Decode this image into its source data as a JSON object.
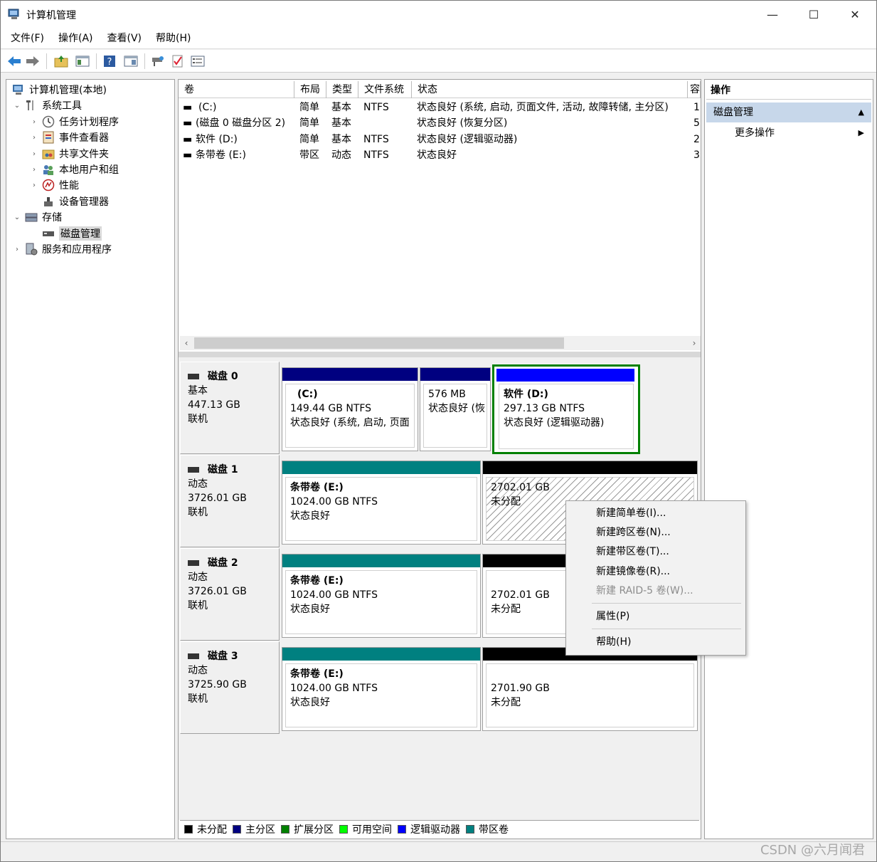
{
  "window": {
    "title": "计算机管理",
    "minimize": "—",
    "maximize": "☐",
    "close": "✕"
  },
  "menu": [
    "文件(F)",
    "操作(A)",
    "查看(V)",
    "帮助(H)"
  ],
  "toolbar_icons": [
    "back-icon",
    "forward-icon",
    "up-folder-icon",
    "show-hide-tree-icon",
    "help-icon",
    "properties-icon",
    "connect-icon",
    "check-icon",
    "list-icon"
  ],
  "tree": [
    {
      "label": "计算机管理(本地)",
      "icon": "computer-management-icon"
    },
    {
      "label": "系统工具",
      "icon": "tools-icon"
    },
    {
      "label": "任务计划程序",
      "icon": "clock-icon"
    },
    {
      "label": "事件查看器",
      "icon": "event-viewer-icon"
    },
    {
      "label": "共享文件夹",
      "icon": "shared-folder-icon"
    },
    {
      "label": "本地用户和组",
      "icon": "users-icon"
    },
    {
      "label": "性能",
      "icon": "performance-icon"
    },
    {
      "label": "设备管理器",
      "icon": "device-manager-icon"
    },
    {
      "label": "存储",
      "icon": "storage-icon"
    },
    {
      "label": "磁盘管理",
      "icon": "disk-icon"
    },
    {
      "label": "服务和应用程序",
      "icon": "services-icon"
    }
  ],
  "volumes": {
    "headers": [
      "卷",
      "布局",
      "类型",
      "文件系统",
      "状态",
      "容"
    ],
    "rows": [
      [
        "(C:)",
        "简单",
        "基本",
        "NTFS",
        "状态良好 (系统, 启动, 页面文件, 活动, 故障转储, 主分区)",
        "1"
      ],
      [
        "(磁盘 0 磁盘分区 2)",
        "简单",
        "基本",
        "",
        "状态良好 (恢复分区)",
        "5"
      ],
      [
        "软件 (D:)",
        "简单",
        "基本",
        "NTFS",
        "状态良好 (逻辑驱动器)",
        "2"
      ],
      [
        "条带卷 (E:)",
        "带区",
        "动态",
        "NTFS",
        "状态良好",
        "3"
      ]
    ]
  },
  "scroll": {
    "left": "‹",
    "right": "›"
  },
  "disks": [
    {
      "name": "磁盘 0",
      "type": "基本",
      "size": "447.13 GB",
      "status": "联机",
      "partitions": [
        {
          "name": "(C:)",
          "size": "149.44 GB NTFS",
          "status": "状态良好 (系统, 启动, 页面"
        },
        {
          "name": "",
          "size": "576 MB",
          "status": "状态良好 (恢"
        },
        {
          "name": "软件  (D:)",
          "size": "297.13 GB NTFS",
          "status": "状态良好 (逻辑驱动器)"
        }
      ]
    },
    {
      "name": "磁盘 1",
      "type": "动态",
      "size": "3726.01 GB",
      "status": "联机",
      "partitions": [
        {
          "name": "条带卷  (E:)",
          "size": "1024.00 GB NTFS",
          "status": "状态良好"
        },
        {
          "name": "",
          "size": "2702.01 GB",
          "status": "未分配"
        }
      ]
    },
    {
      "name": "磁盘 2",
      "type": "动态",
      "size": "3726.01 GB",
      "status": "联机",
      "partitions": [
        {
          "name": "条带卷  (E:)",
          "size": "1024.00 GB NTFS",
          "status": "状态良好"
        },
        {
          "name": "",
          "size": "2702.01 GB",
          "status": "未分配"
        }
      ]
    },
    {
      "name": "磁盘 3",
      "type": "动态",
      "size": "3725.90 GB",
      "status": "联机",
      "partitions": [
        {
          "name": "条带卷  (E:)",
          "size": "1024.00 GB NTFS",
          "status": "状态良好"
        },
        {
          "name": "",
          "size": "2701.90 GB",
          "status": "未分配"
        }
      ]
    }
  ],
  "legend": [
    {
      "label": "未分配",
      "color": "#000000"
    },
    {
      "label": "主分区",
      "color": "#000080"
    },
    {
      "label": "扩展分区",
      "color": "#008000"
    },
    {
      "label": "可用空间",
      "color": "#00ff00"
    },
    {
      "label": "逻辑驱动器",
      "color": "#0000ff"
    },
    {
      "label": "带区卷",
      "color": "#008080"
    }
  ],
  "colors": {
    "primary": "#000080",
    "logical": "#0000ff",
    "striped": "#008080",
    "unallocated": "#000000",
    "selection_border": "#008000"
  },
  "actions": {
    "header": "操作",
    "section": "磁盘管理",
    "section_arrow": "▲",
    "more": "更多操作",
    "more_arrow": "▶"
  },
  "context_menu": {
    "items": [
      "新建简单卷(I)...",
      "新建跨区卷(N)...",
      "新建带区卷(T)...",
      "新建镜像卷(R)...",
      "新建 RAID-5 卷(W)..."
    ],
    "properties": "属性(P)",
    "help": "帮助(H)"
  },
  "watermark": "CSDN @六月闻君"
}
